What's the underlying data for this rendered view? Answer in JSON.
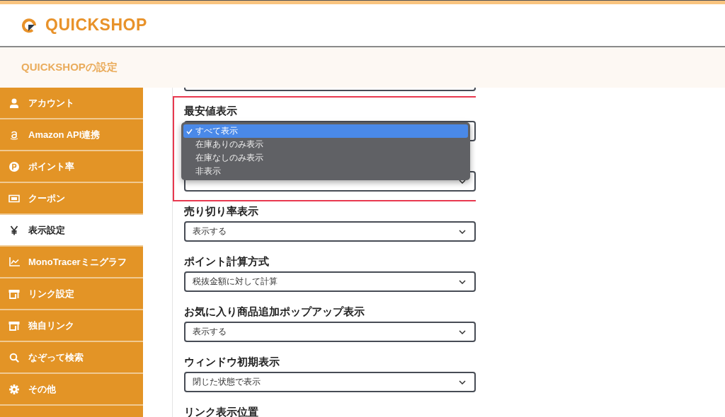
{
  "header": {
    "logo_text": "QUICKSHOP"
  },
  "page_title": "QUICKSHOPの設定",
  "sidebar": {
    "items": [
      {
        "label": "アカウント",
        "kind": "user",
        "selected": false
      },
      {
        "label": "Amazon API連携",
        "kind": "amazon",
        "selected": false
      },
      {
        "label": "ポイント率",
        "kind": "point",
        "selected": false
      },
      {
        "label": "クーポン",
        "kind": "ticket",
        "selected": false
      },
      {
        "label": "表示設定",
        "kind": "yen",
        "selected": true
      },
      {
        "label": "MonoTracerミニグラフ",
        "kind": "chart",
        "selected": false
      },
      {
        "label": "リンク設定",
        "kind": "store",
        "selected": false
      },
      {
        "label": "独自リンク",
        "kind": "store",
        "selected": false
      },
      {
        "label": "なぞって検索",
        "kind": "search",
        "selected": false
      },
      {
        "label": "その他",
        "kind": "gear",
        "selected": false
      }
    ]
  },
  "settings": [
    {
      "kind": "select-cut"
    },
    {
      "kind": "select",
      "label": "最安値表示",
      "open": true,
      "options": [
        {
          "label": "すべて表示",
          "selected": true
        },
        {
          "label": "在庫ありのみ表示",
          "selected": false
        },
        {
          "label": "在庫なしのみ表示",
          "selected": false
        },
        {
          "label": "非表示",
          "selected": false
        }
      ]
    },
    {
      "kind": "select"
    },
    {
      "kind": "select",
      "label": "売り切り率表示",
      "value": "表示する"
    },
    {
      "kind": "select",
      "label": "ポイント計算方式",
      "value": "税抜金額に対して計算"
    },
    {
      "kind": "select",
      "label": "お気に入り商品追加ポップアップ表示",
      "value": "表示する"
    },
    {
      "kind": "select",
      "label": "ウィンドウ初期表示",
      "value": "閉じた状態で表示"
    },
    {
      "kind": "heading",
      "label": "リンク表示位置"
    }
  ]
}
